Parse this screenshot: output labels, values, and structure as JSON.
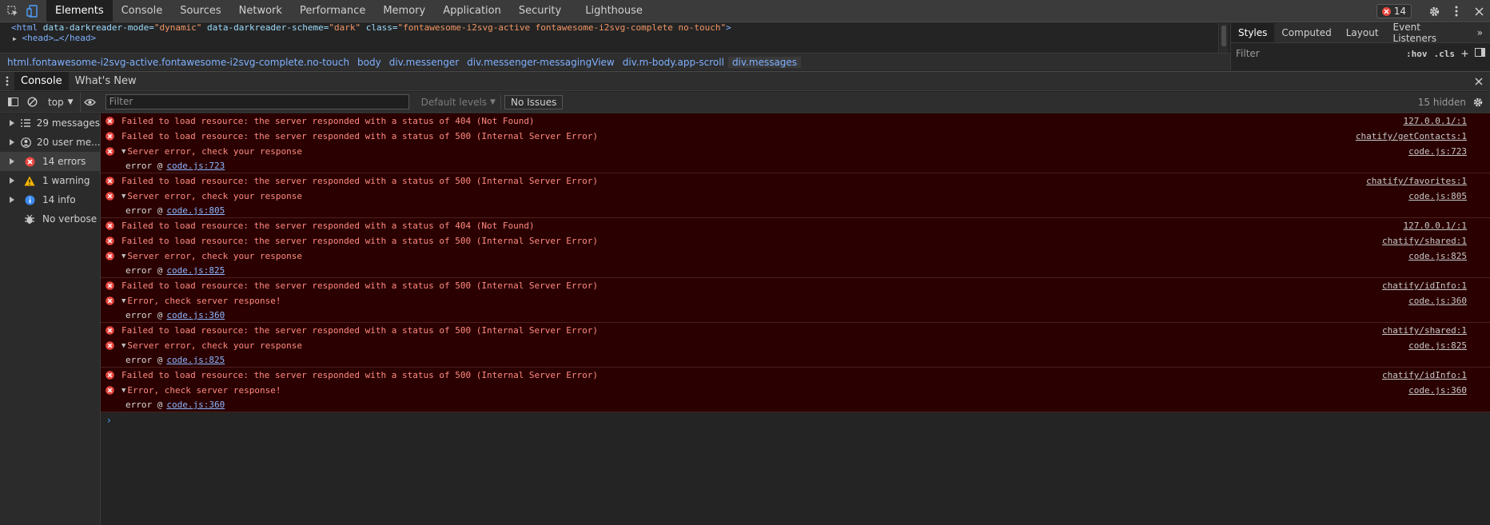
{
  "toolbar": {
    "tabs": [
      "Elements",
      "Console",
      "Sources",
      "Network",
      "Performance",
      "Memory",
      "Application",
      "Security",
      "Lighthouse"
    ],
    "active_tab": "Elements",
    "error_badge": "14"
  },
  "elements": {
    "html_line": {
      "open": "<html",
      "attr1_name": " data-darkreader-mode=",
      "attr1_value": "\"dynamic\"",
      "attr2_name": " data-darkreader-scheme=",
      "attr2_value": "\"dark\"",
      "attr3_name": " class=",
      "attr3_value": "\"fontawesome-i2svg-active fontawesome-i2svg-complete no-touch\"",
      "close": ">"
    },
    "head_line": "<head>…</head>"
  },
  "styles": {
    "tabs": [
      "Styles",
      "Computed",
      "Layout",
      "Event Listeners"
    ],
    "filter_placeholder": "Filter",
    "hov": ":hov",
    "cls": ".cls"
  },
  "breadcrumb": [
    "html.fontawesome-i2svg-active.fontawesome-i2svg-complete.no-touch",
    "body",
    "div.messenger",
    "div.messenger-messagingView",
    "div.m-body.app-scroll",
    "div.messages"
  ],
  "drawer": {
    "tabs": [
      "Console",
      "What's New"
    ]
  },
  "console_toolbar": {
    "context": "top",
    "filter_placeholder": "Filter",
    "levels": "Default levels",
    "issues": "No Issues",
    "hidden": "15 hidden"
  },
  "sidebar": [
    {
      "label": "29 messages",
      "icon": "list-icon"
    },
    {
      "label": "20 user me...",
      "icon": "user-icon"
    },
    {
      "label": "14 errors",
      "icon": "error-icon"
    },
    {
      "label": "1 warning",
      "icon": "warning-icon"
    },
    {
      "label": "14 info",
      "icon": "info-icon"
    },
    {
      "label": "No verbose",
      "icon": "bug-icon"
    }
  ],
  "messages": [
    {
      "rows": [
        {
          "text": "Failed to load resource: the server responded with a status of 404 (Not Found)",
          "src": "127.0.0.1/:1"
        },
        {
          "text": "Failed to load resource: the server responded with a status of 500 (Internal Server Error)",
          "src": "chatify/getContacts:1"
        },
        {
          "text": "Server error, check your response",
          "src": "code.js:723",
          "expanded": true
        }
      ],
      "stack": {
        "fn": "error @",
        "link": "code.js:723"
      }
    },
    {
      "rows": [
        {
          "text": "Failed to load resource: the server responded with a status of 500 (Internal Server Error)",
          "src": "chatify/favorites:1"
        },
        {
          "text": "Server error, check your response",
          "src": "code.js:805",
          "expanded": true
        }
      ],
      "stack": {
        "fn": "error @",
        "link": "code.js:805"
      }
    },
    {
      "rows": [
        {
          "text": "Failed to load resource: the server responded with a status of 404 (Not Found)",
          "src": "127.0.0.1/:1"
        },
        {
          "text": "Failed to load resource: the server responded with a status of 500 (Internal Server Error)",
          "src": "chatify/shared:1"
        },
        {
          "text": "Server error, check your response",
          "src": "code.js:825",
          "expanded": true
        }
      ],
      "stack": {
        "fn": "error @",
        "link": "code.js:825"
      }
    },
    {
      "rows": [
        {
          "text": "Failed to load resource: the server responded with a status of 500 (Internal Server Error)",
          "src": "chatify/idInfo:1"
        },
        {
          "text": "Error, check server response!",
          "src": "code.js:360",
          "expanded": true
        }
      ],
      "stack": {
        "fn": "error @",
        "link": "code.js:360"
      }
    },
    {
      "rows": [
        {
          "text": "Failed to load resource: the server responded with a status of 500 (Internal Server Error)",
          "src": "chatify/shared:1"
        },
        {
          "text": "Server error, check your response",
          "src": "code.js:825",
          "expanded": true
        }
      ],
      "stack": {
        "fn": "error @",
        "link": "code.js:825"
      }
    },
    {
      "rows": [
        {
          "text": "Failed to load resource: the server responded with a status of 500 (Internal Server Error)",
          "src": "chatify/idInfo:1"
        },
        {
          "text": "Error, check server response!",
          "src": "code.js:360",
          "expanded": true
        }
      ],
      "stack": {
        "fn": "error @",
        "link": "code.js:360"
      }
    }
  ],
  "prompt": "›"
}
